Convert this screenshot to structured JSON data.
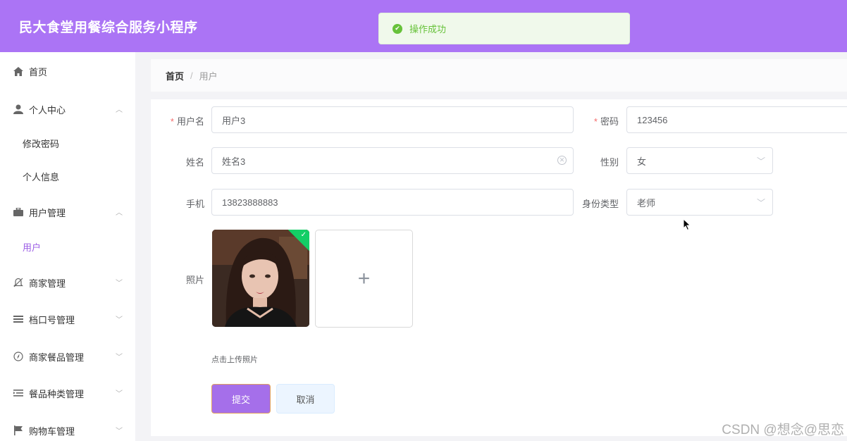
{
  "app": {
    "title": "民大食堂用餐综合服务小程序"
  },
  "toast": {
    "message": "操作成功"
  },
  "sidebar": {
    "items": [
      {
        "label": "首页",
        "icon": "home-icon"
      },
      {
        "label": "个人中心",
        "icon": "user-icon",
        "expanded": true,
        "children": [
          "修改密码",
          "个人信息"
        ]
      },
      {
        "label": "用户管理",
        "icon": "briefcase-icon",
        "expanded": true,
        "children": [
          "用户"
        ]
      },
      {
        "label": "商家管理",
        "icon": "bell-icon"
      },
      {
        "label": "档口号管理",
        "icon": "list-icon"
      },
      {
        "label": "商家餐品管理",
        "icon": "compass-icon"
      },
      {
        "label": "餐品种类管理",
        "icon": "indent-icon"
      },
      {
        "label": "购物车管理",
        "icon": "flag-icon"
      }
    ],
    "active": "用户"
  },
  "breadcrumb": {
    "home": "首页",
    "separator": "/",
    "current": "用户"
  },
  "form": {
    "username": {
      "label": "用户名",
      "value": "用户3",
      "required": true
    },
    "password": {
      "label": "密码",
      "value": "123456",
      "required": true
    },
    "name": {
      "label": "姓名",
      "value": "姓名3"
    },
    "gender": {
      "label": "性别",
      "value": "女"
    },
    "phone": {
      "label": "手机",
      "value": "13823888883"
    },
    "identity": {
      "label": "身份类型",
      "value": "老师"
    },
    "photo": {
      "label": "照片",
      "hint": "点击上传照片",
      "uploaded": true
    },
    "required_mark": "*"
  },
  "actions": {
    "submit": "提交",
    "cancel": "取消"
  },
  "watermark": "CSDN @想念@思恋",
  "colors": {
    "header": "#ab74f5",
    "accent": "#a56fea",
    "success": "#67c23a"
  }
}
